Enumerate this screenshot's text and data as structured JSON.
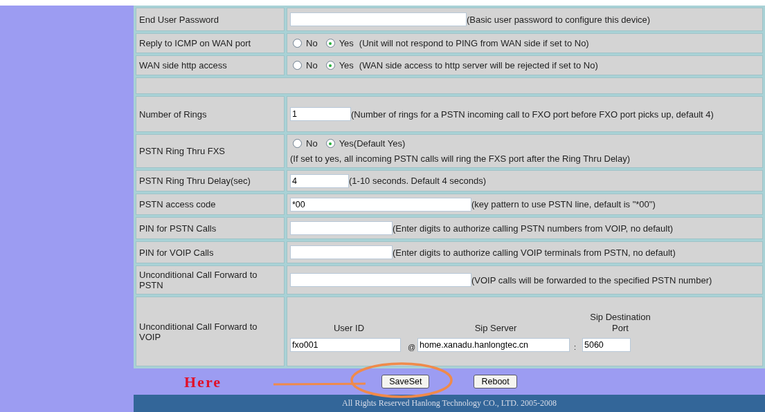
{
  "rows": [
    {
      "kind": "input",
      "label": "End User Password",
      "value": "",
      "note": "(Basic user password to configure this device)"
    },
    {
      "kind": "radio",
      "label": "Reply to ICMP on WAN port",
      "options": [
        {
          "label": "No",
          "selected": false
        },
        {
          "label": "Yes",
          "selected": true
        }
      ],
      "note": "(Unit will not respond to PING from WAN side if set to No)"
    },
    {
      "kind": "radio",
      "label": "WAN side http access",
      "options": [
        {
          "label": "No",
          "selected": false
        },
        {
          "label": "Yes",
          "selected": true
        }
      ],
      "note": "(WAN side access to http server will be rejected if set to No)"
    },
    {
      "kind": "spacer"
    },
    {
      "kind": "input",
      "label": "Number of Rings",
      "value": "1",
      "note": "(Number of rings for a PSTN incoming call to FXO port before FXO port picks up, default 4)"
    },
    {
      "kind": "radio_block",
      "label": "PSTN Ring Thru FXS",
      "options": [
        {
          "label": "No",
          "selected": false
        },
        {
          "label": "Yes(Default Yes)",
          "selected": true
        }
      ],
      "note": "(If set to yes, all incoming PSTN calls will ring the FXS port after the Ring Thru Delay)"
    },
    {
      "kind": "input",
      "label": "PSTN Ring Thru Delay(sec)",
      "value": "4",
      "note": "(1-10 seconds. Default 4 seconds)"
    },
    {
      "kind": "input",
      "label": "PSTN access code",
      "value": "*00",
      "note": "(key pattern to use PSTN line, default is \"*00\")"
    },
    {
      "kind": "input",
      "label": "PIN for PSTN Calls",
      "value": "",
      "note": "(Enter digits to authorize calling PSTN numbers from VOIP, no default)"
    },
    {
      "kind": "input",
      "label": "PIN for VOIP Calls",
      "value": "",
      "note": "(Enter digits to authorize calling VOIP terminals from PSTN, no default)"
    },
    {
      "kind": "input",
      "label": "Unconditional Call Forward to PSTN",
      "value": "",
      "note": "(VOIP calls will be forwarded to the specified PSTN number)"
    },
    {
      "kind": "voip",
      "label": "Unconditional Call Forward to VOIP",
      "user_id": {
        "heading": "User ID",
        "value": "fxo001"
      },
      "at": "@",
      "sip_server": {
        "heading": "Sip Server",
        "value": "home.xanadu.hanlongtec.cn"
      },
      "colon": ":",
      "port": {
        "heading": "Sip Destination Port",
        "value": "5060"
      }
    }
  ],
  "buttons": [
    "SaveSet",
    "Reboot"
  ],
  "annotation": {
    "text": "Here"
  },
  "footer": "All Rights Reserved Hanlong Technology CO., LTD. 2005-2008"
}
